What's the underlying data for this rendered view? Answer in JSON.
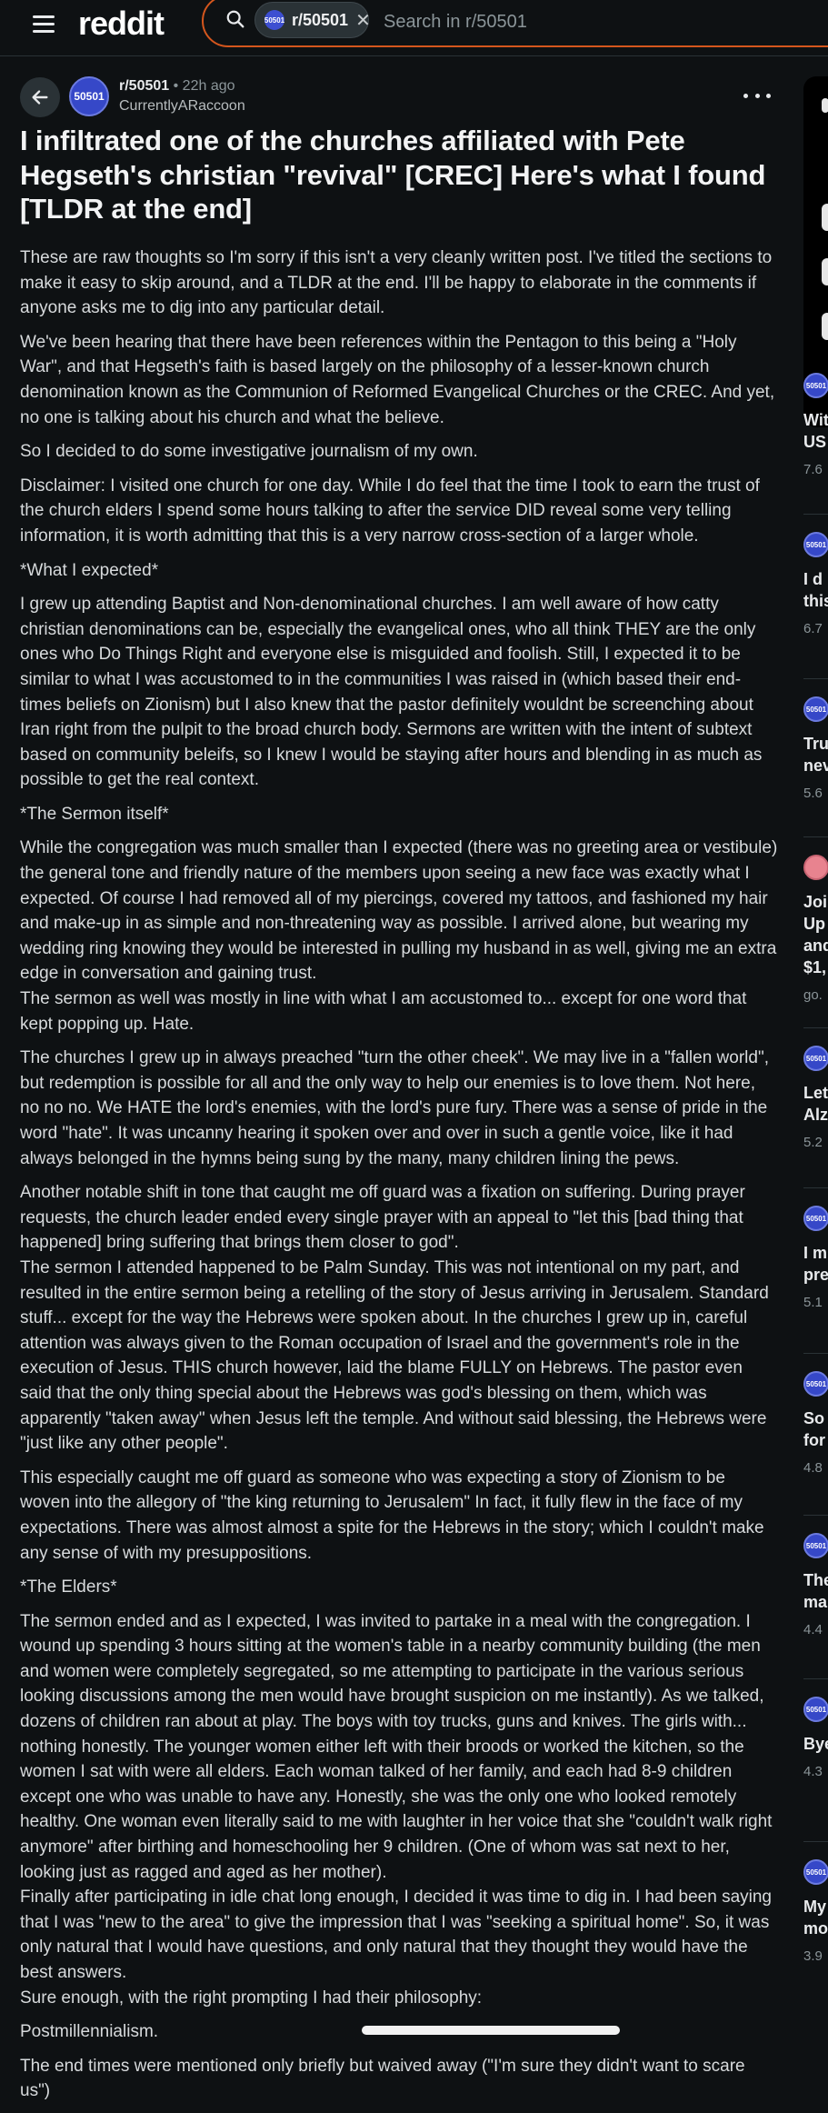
{
  "header": {
    "logo_text": "reddit",
    "search_chip_label": "r/50501",
    "search_placeholder": "Search in r/50501"
  },
  "post": {
    "subreddit": "r/50501",
    "subreddit_avatar": "50501",
    "time_ago": "22h ago",
    "author": "CurrentlyARaccoon",
    "title": "I infiltrated one of the churches affiliated with Pete Hegseth's christian \"revival\" [CREC] Here's what I found [TLDR at the end]",
    "paragraphs": [
      "These are raw thoughts so I'm sorry if this isn't a very cleanly written post. I've titled the sections to make it easy to skip around, and a TLDR at the end. I'll be happy to elaborate in the comments if anyone asks me to dig into any particular detail.",
      "We've been hearing that there have been references within the Pentagon to this being a \"Holy War\", and that Hegseth's faith is based largely on the philosophy of a lesser-known church denomination known as the Communion of Reformed Evangelical Churches or the CREC. And yet, no one is talking about his church and what the believe.",
      "So I decided to do some investigative journalism of my own.",
      "Disclaimer: I visited one church for one day. While I do feel that the time I took to earn the trust of the church elders I spend some hours talking to after the service DID reveal some very telling information, it is worth admitting that this is a very narrow cross-section of a larger whole.",
      "*What I expected*",
      "I grew up attending Baptist and Non-denominational churches. I am well aware of how catty christian denominations can be, especially the evangelical ones, who all think THEY are the only ones who Do Things Right and everyone else is misguided and foolish. Still, I expected it to be similar to what I was accustomed to in the communities I was raised in (which based their end-times beliefs on Zionism) but I also knew that the pastor definitely wouldnt be screenching about Iran right from the pulpit to the broad church body. Sermons are written with the intent of subtext based on community beleifs, so I knew I would be staying after hours and blending in as much as possible to get the real context.",
      "*The Sermon itself*",
      "While the congregation was much smaller than I expected (there was no greeting area or vestibule) the general tone and friendly nature of the members upon seeing a new face was exactly what I expected. Of course I had removed all of my piercings, covered my tattoos, and fashioned my hair and make-up in as simple and non-threatening way as possible. I arrived alone, but wearing my wedding ring knowing they would be interested in pulling my husband in as well, giving me an extra edge in conversation and gaining trust.\nThe sermon as well was mostly in line with what I am accustomed to... except for one word that kept popping up. Hate.",
      "The churches I grew up in always preached \"turn the other cheek\". We may live in a \"fallen world\", but redemption is possible for all and the only way to help our enemies is to love them. Not here, no no no. We HATE the lord's enemies, with the lord's pure fury. There was a sense of pride in the word \"hate\". It was uncanny hearing it spoken over and over in such a gentle voice, like it had always belonged in the hymns being sung by the many, many children lining the pews.",
      "Another notable shift in tone that caught me off guard was a fixation on suffering. During prayer requests, the church leader ended every single prayer with an appeal to \"let this [bad thing that happened] bring suffering that brings them closer to god\".\nThe sermon I attended happened to be Palm Sunday. This was not intentional on my part, and resulted in the entire sermon being a retelling of the story of Jesus arriving in Jerusalem. Standard stuff... except for the way the Hebrews were spoken about. In the churches I grew up in, careful attention was always given to the Roman occupation of Israel and the government's role in the execution of Jesus. THIS church however, laid the blame FULLY on Hebrews. The pastor even said that the only thing special about the Hebrews was god's blessing on them, which was apparently \"taken away\" when Jesus left the temple. And without said blessing, the Hebrews were \"just like any other people\".",
      "This especially caught me off guard as someone who was expecting a story of Zionism to be woven into the allegory of \"the king returning to Jerusalem\" In fact, it fully flew in the face of my expectations. There was almost almost a spite for the Hebrews in the story; which I couldn't make any sense of with my presuppositions.",
      "*The Elders*",
      "The sermon ended and as I expected, I was invited to partake in a meal with the congregation. I wound up spending 3 hours sitting at the women's table in a nearby community building (the men and women were completely segregated, so me attempting to participate in the various serious looking discussions among the men would have brought suspicion on me instantly). As we talked, dozens of children ran about at play. The boys with toy trucks, guns and knives. The girls with... nothing honestly. The younger women either left with their broods or worked the kitchen, so the women I sat with were all elders. Each woman talked of her family, and each had 8-9 children except one who was unable to have any. Honestly, she was the only one who looked remotely healthy. One woman even literally said to me with laughter in her voice that she \"couldn't walk right anymore\" after birthing and homeschooling her 9 children. (One of whom was sat next to her, looking just as ragged and aged as her mother).\nFinally after participating in idle chat long enough, I decided it was time to dig in. I had been saying that I was \"new to the area\" to give the impression that I was \"seeking a spiritual home\". So, it was only natural that I would have questions, and only natural that they thought they would have the best answers.\nSure enough, with the right prompting I had their philosophy:",
      "Postmillennialism.",
      "The end times were mentioned only briefly but waived away (\"I'm sure they didn't want to scare us\")"
    ]
  },
  "sidebar": {
    "items": [
      {
        "avatar": "50501",
        "title": "Wit",
        "title2": "US",
        "meta": "7.6"
      },
      {
        "avatar": "50501",
        "title": "I d",
        "title2": "this",
        "meta": "6.7"
      },
      {
        "avatar": "50501",
        "title": "Tru",
        "title2": "nev",
        "meta": "5.6"
      },
      {
        "avatar": "",
        "title": "Joi",
        "title2": "Up",
        "title3": "and",
        "title4": "$1,",
        "meta": "go."
      },
      {
        "avatar": "50501",
        "title": "Let",
        "title2": "Alz",
        "meta": "5.2"
      },
      {
        "avatar": "50501",
        "title": "I m",
        "title2": "pre",
        "meta": "5.1"
      },
      {
        "avatar": "50501",
        "title": "So",
        "title2": "for",
        "meta": "4.8"
      },
      {
        "avatar": "50501",
        "title": "The",
        "title2": "ma",
        "meta": "4.4"
      },
      {
        "avatar": "50501",
        "title": "Bye",
        "title2": "",
        "meta": "4.3"
      },
      {
        "avatar": "50501",
        "title": "My",
        "title2": "mo",
        "meta": "3.9"
      }
    ]
  },
  "colors": {
    "background": "#0e1113",
    "search_border": "#d4561d",
    "subreddit_avatar": "#3648c8"
  }
}
